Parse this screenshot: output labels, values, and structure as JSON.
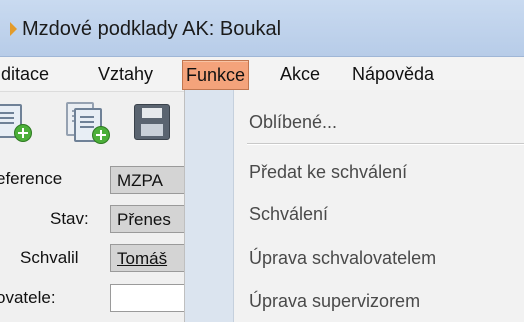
{
  "window": {
    "title": "Mzdové podklady AK: Boukal"
  },
  "menubar": {
    "items": [
      {
        "label": "ditace"
      },
      {
        "label": "Vztahy"
      },
      {
        "label": "Funkce"
      },
      {
        "label": "Akce"
      },
      {
        "label": "Nápověda"
      }
    ]
  },
  "toolbar": {
    "icons": [
      "new-document-icon",
      "new-copy-document-icon",
      "save-icon"
    ]
  },
  "form": {
    "reference": {
      "label": "eference",
      "value": "MZPA"
    },
    "stav": {
      "label": "Stav:",
      "value": "Přenes"
    },
    "schvalil": {
      "label": "Schvalil",
      "value": "Tomáš"
    },
    "schvalovatele": {
      "label": "ovatele:",
      "value": ""
    }
  },
  "funkce_menu": {
    "items": [
      {
        "label": "Oblíbené..."
      },
      {
        "label": "Předat ke schválení"
      },
      {
        "label": "Schválení"
      },
      {
        "label": "Úprava schvalovatelem"
      },
      {
        "label": "Úprava supervizorem"
      }
    ]
  },
  "colors": {
    "active_menu": "#f4a37b",
    "titlebar": "#c9daf0",
    "menu_gutter": "#dbe4ef"
  }
}
